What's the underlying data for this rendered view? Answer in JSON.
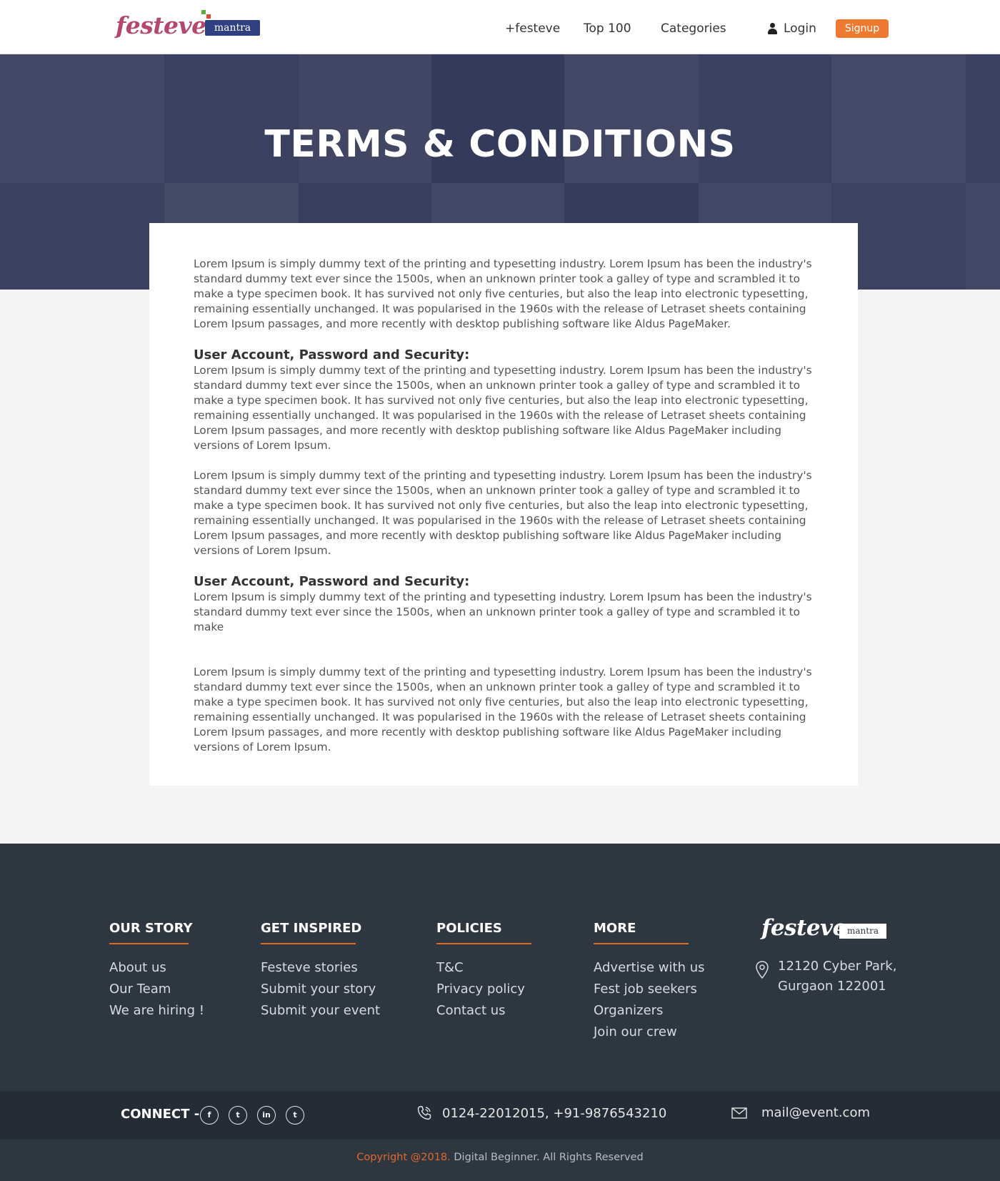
{
  "header": {
    "logo_text": "festeve",
    "logo_tag": "mantra",
    "nav": [
      {
        "label": "+festeve"
      },
      {
        "label": "Top 100"
      },
      {
        "label": "Categories"
      }
    ],
    "login_label": "Login",
    "signup_label": "Signup"
  },
  "hero": {
    "title": "TERMS & CONDITIONS"
  },
  "content": {
    "p1": "Lorem Ipsum is simply dummy text of the printing and typesetting industry. Lorem Ipsum has been the industry's standard dummy text ever since the 1500s, when an unknown printer took a galley of type and scrambled it to make a type specimen book. It has survived not only five centuries, but also the leap into electronic typesetting, remaining essentially unchanged. It was popularised in the 1960s with the release of Letraset sheets containing Lorem Ipsum passages, and more recently with desktop publishing software like Aldus PageMaker.",
    "h1": "User Account, Password and Security:",
    "p2": "Lorem Ipsum is simply dummy text of the printing and typesetting industry. Lorem Ipsum has been the industry's standard dummy text ever since the 1500s, when an unknown printer took a galley of type and scrambled it to make a type specimen book. It has survived not only five centuries, but also the leap into electronic typesetting, remaining essentially unchanged. It was popularised in the 1960s with the release of Letraset sheets containing Lorem Ipsum passages, and more recently with desktop publishing software like Aldus PageMaker including versions of Lorem Ipsum.",
    "p3": "Lorem Ipsum is simply dummy text of the printing and typesetting industry. Lorem Ipsum has been the industry's standard dummy text ever since the 1500s, when an unknown printer took a galley of type and scrambled it to make a type specimen book. It has survived not only five centuries, but also the leap into electronic typesetting, remaining essentially unchanged. It was popularised in the 1960s with the release of Letraset sheets containing Lorem Ipsum passages, and more recently with desktop publishing software like Aldus PageMaker including versions of Lorem Ipsum.",
    "h2": "User Account, Password and Security:",
    "p4": "Lorem Ipsum is simply dummy text of the printing and typesetting industry. Lorem Ipsum has been the industry's standard dummy text ever since the 1500s, when an unknown printer took a galley of type and scrambled it to make",
    "p5": "Lorem Ipsum is simply dummy text of the printing and typesetting industry. Lorem Ipsum has been the industry's standard dummy text ever since the 1500s, when an unknown printer took a galley of type and scrambled it to make a type specimen book. It has survived not only five centuries, but also the leap into electronic typesetting, remaining essentially unchanged. It was popularised in the 1960s with the release of Letraset sheets containing Lorem Ipsum passages, and more recently with desktop publishing software like Aldus PageMaker including versions of Lorem Ipsum."
  },
  "footer": {
    "columns": [
      {
        "title": "OUR STORY",
        "links": [
          "About us",
          "Our Team",
          "We are hiring !"
        ]
      },
      {
        "title": "GET INSPIRED",
        "links": [
          "Festeve stories",
          "Submit your story",
          "Submit your event"
        ]
      },
      {
        "title": "POLICIES",
        "links": [
          "T&C",
          "Privacy policy",
          "Contact us"
        ]
      },
      {
        "title": "MORE",
        "links": [
          "Advertise with us",
          "Fest job seekers",
          "Organizers",
          "Join our crew"
        ]
      }
    ],
    "logo_text": "festeve",
    "logo_tag": "mantra",
    "address_line1": "12120 Cyber Park,",
    "address_line2": "Gurgaon 122001",
    "connect_label": "CONNECT -",
    "social": [
      {
        "icon": "facebook-icon",
        "glyph": "f"
      },
      {
        "icon": "twitter-icon",
        "glyph": "t"
      },
      {
        "icon": "linkedin-icon",
        "glyph": "in"
      },
      {
        "icon": "twitter-icon",
        "glyph": "t"
      }
    ],
    "phone": "0124-22012015, +91-9876543210",
    "email": "mail@event.com",
    "copyright_accent": "Copyright @2018.",
    "copyright_rest": " Digital Beginner. All Rights Reserved"
  },
  "colors": {
    "accent": "#ee7a32",
    "footer_bg": "#2e3640",
    "hero_tint": "#464d6b"
  }
}
